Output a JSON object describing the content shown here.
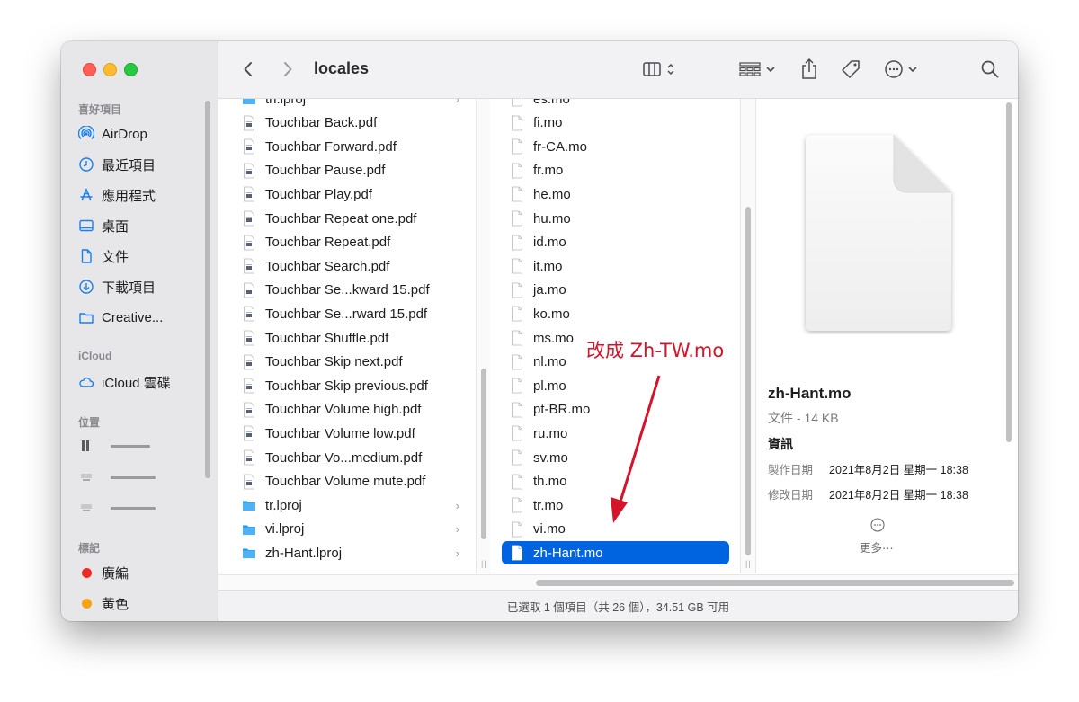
{
  "window": {
    "title": "locales"
  },
  "sidebar": {
    "sections": {
      "favorites": "喜好項目",
      "icloud": "iCloud",
      "locations": "位置",
      "tags": "標記"
    },
    "favorites": [
      {
        "label": "AirDrop",
        "icon": "airdrop-icon"
      },
      {
        "label": "最近項目",
        "icon": "clock-icon"
      },
      {
        "label": "應用程式",
        "icon": "applications-icon"
      },
      {
        "label": "桌面",
        "icon": "desktop-icon"
      },
      {
        "label": "文件",
        "icon": "document-icon"
      },
      {
        "label": "下載項目",
        "icon": "download-icon"
      },
      {
        "label": "Creative...",
        "icon": "folder-icon"
      }
    ],
    "icloud": [
      {
        "label": "iCloud 雲碟",
        "icon": "cloud-icon"
      }
    ],
    "tags": [
      {
        "label": "廣編",
        "color": "#ee2a24"
      },
      {
        "label": "黃色",
        "color": "#f6a414"
      }
    ]
  },
  "toolbar": {
    "back": "back-chevron-icon",
    "forward": "forward-chevron-icon",
    "view": "column-view-icon",
    "group": "group-icon",
    "share": "share-icon",
    "tag": "tag-icon",
    "more": "more-icon",
    "search": "search-icon"
  },
  "column1": [
    {
      "name": "th.lproj",
      "type": "folder",
      "chevron": "›"
    },
    {
      "name": "Touchbar Back.pdf",
      "type": "pdf"
    },
    {
      "name": "Touchbar Forward.pdf",
      "type": "pdf"
    },
    {
      "name": "Touchbar Pause.pdf",
      "type": "pdf"
    },
    {
      "name": "Touchbar Play.pdf",
      "type": "pdf"
    },
    {
      "name": "Touchbar Repeat one.pdf",
      "type": "pdf"
    },
    {
      "name": "Touchbar Repeat.pdf",
      "type": "pdf"
    },
    {
      "name": "Touchbar Search.pdf",
      "type": "pdf"
    },
    {
      "name": "Touchbar Se...kward 15.pdf",
      "type": "pdf"
    },
    {
      "name": "Touchbar Se...rward 15.pdf",
      "type": "pdf"
    },
    {
      "name": "Touchbar Shuffle.pdf",
      "type": "pdf"
    },
    {
      "name": "Touchbar Skip next.pdf",
      "type": "pdf"
    },
    {
      "name": "Touchbar Skip previous.pdf",
      "type": "pdf"
    },
    {
      "name": "Touchbar Volume high.pdf",
      "type": "pdf"
    },
    {
      "name": "Touchbar Volume low.pdf",
      "type": "pdf"
    },
    {
      "name": "Touchbar Vo...medium.pdf",
      "type": "pdf"
    },
    {
      "name": "Touchbar Volume mute.pdf",
      "type": "pdf"
    },
    {
      "name": "tr.lproj",
      "type": "folder",
      "chevron": "›"
    },
    {
      "name": "vi.lproj",
      "type": "folder",
      "chevron": "›"
    },
    {
      "name": "zh-Hant.lproj",
      "type": "folder",
      "chevron": "›"
    }
  ],
  "column2": [
    {
      "name": "es.mo"
    },
    {
      "name": "fi.mo"
    },
    {
      "name": "fr-CA.mo"
    },
    {
      "name": "fr.mo"
    },
    {
      "name": "he.mo"
    },
    {
      "name": "hu.mo"
    },
    {
      "name": "id.mo"
    },
    {
      "name": "it.mo"
    },
    {
      "name": "ja.mo"
    },
    {
      "name": "ko.mo"
    },
    {
      "name": "ms.mo"
    },
    {
      "name": "nl.mo"
    },
    {
      "name": "pl.mo"
    },
    {
      "name": "pt-BR.mo"
    },
    {
      "name": "ru.mo"
    },
    {
      "name": "sv.mo"
    },
    {
      "name": "th.mo"
    },
    {
      "name": "tr.mo"
    },
    {
      "name": "vi.mo"
    },
    {
      "name": "zh-Hant.mo",
      "selected": true
    }
  ],
  "preview": {
    "name": "zh-Hant.mo",
    "kind": "文件 - 14 KB",
    "info_title": "資訊",
    "created_label": "製作日期",
    "created_value": "2021年8月2日 星期一 18:38",
    "modified_label": "修改日期",
    "modified_value": "2021年8月2日 星期一 18:38",
    "more_label": "更多⋯"
  },
  "status": "已選取 1 個項目（共 26 個），34.51 GB 可用",
  "annotation": {
    "text": "改成 Zh-TW.mo",
    "color": "#d3142a"
  },
  "colors": {
    "selection": "#0064e0",
    "sidebar": "#e7e6e9",
    "folder": "#1a9bf0"
  }
}
